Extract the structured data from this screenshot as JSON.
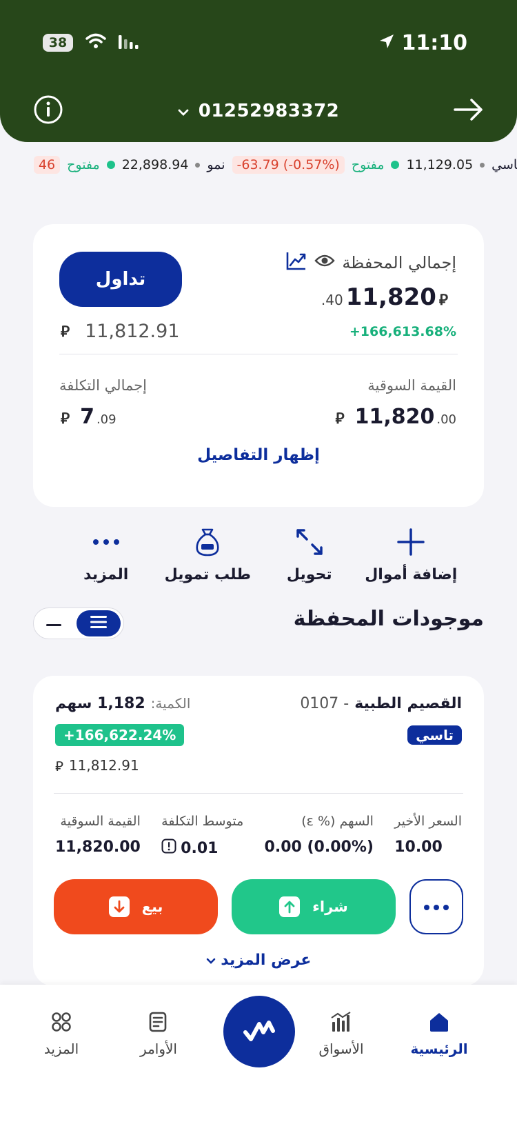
{
  "status_bar": {
    "battery": "38",
    "time": "11:10"
  },
  "header": {
    "account_number": "01252983372"
  },
  "ticker": {
    "tasi_label": "تاسي",
    "tasi_value": "11,129.05",
    "tasi_state": "مفتوح",
    "tasi_change": "-63.79 (-0.57%)",
    "nomu_label": "نمو",
    "nomu_value": "22,898.94",
    "nomu_state": "مفتوح",
    "trailing_value": "46"
  },
  "summary": {
    "title": "إجمالي المحفظة",
    "trade_label": "تداول",
    "total_int": "11,820",
    "total_dec": ".40",
    "currency": "ɛ",
    "gain_pct": "+166,613.68%",
    "secondary_value": "11,812.91",
    "market_value_label": "القيمة السوقية",
    "market_value_int": "11,820",
    "market_value_dec": ".00",
    "total_cost_label": "إجمالي التكلفة",
    "total_cost_int": "7",
    "total_cost_dec": ".09",
    "show_details_label": "إظهار التفاصيل"
  },
  "actions": [
    {
      "label": "إضافة أموال",
      "icon": "plus-icon"
    },
    {
      "label": "تحويل",
      "icon": "transfer-arrows-icon"
    },
    {
      "label": "طلب تمويل",
      "icon": "money-bag-icon"
    },
    {
      "label": "المزيد",
      "icon": "ellipsis-icon"
    }
  ],
  "holdings": {
    "title": "موجودات المحفظة",
    "item": {
      "name": "القصيم الطبية",
      "code": "- 0107",
      "market_badge": "تاسي",
      "qty_label": "الكمية:",
      "qty_value": "1,182 سهم",
      "gain_pct": "+166,622.24%",
      "cost_value": "11,812.91",
      "cols": [
        {
          "label": "السعر الأخير",
          "value": "10.00"
        },
        {
          "label": "السهم (% ɛ)",
          "value": "0.00 (0.00%)"
        },
        {
          "label": "متوسط التكلفة",
          "value": "0.01"
        },
        {
          "label": "القيمة السوقية",
          "value": "11,820.00"
        }
      ],
      "buy_label": "شراء",
      "sell_label": "بيع",
      "show_more_label": "عرض المزيد"
    }
  },
  "tabbar": {
    "home": "الرئيسية",
    "markets": "الأسواق",
    "orders": "الأوامر",
    "more": "المزيد"
  },
  "colors": {
    "header_green": "#27471a",
    "brand_blue": "#0d2e9c",
    "positive_green": "#1ec28b",
    "sell_orange": "#f04a1d",
    "negative_red": "#d9432f"
  }
}
